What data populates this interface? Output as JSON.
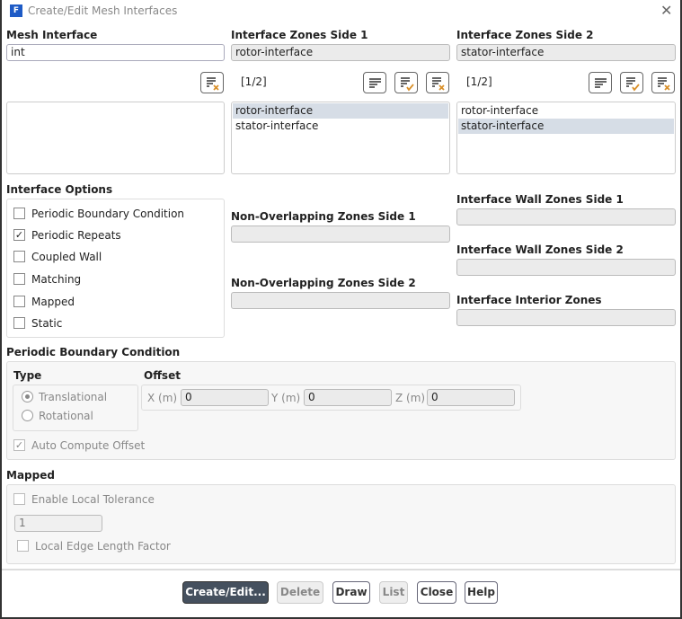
{
  "window": {
    "title": "Create/Edit Mesh Interfaces",
    "app_icon": "F"
  },
  "mesh_interface": {
    "label": "Mesh Interface",
    "value": "int"
  },
  "side1": {
    "label": "Interface Zones Side 1",
    "value": "rotor-interface",
    "count": "[1/2]",
    "items": [
      "rotor-interface",
      "stator-interface"
    ],
    "selected": 0
  },
  "side2": {
    "label": "Interface Zones Side 2",
    "value": "stator-interface",
    "count": "[1/2]",
    "items": [
      "rotor-interface",
      "stator-interface"
    ],
    "selected": 1
  },
  "interface_options": {
    "label": "Interface Options",
    "items": [
      {
        "label": "Periodic Boundary Condition",
        "checked": false
      },
      {
        "label": "Periodic Repeats",
        "checked": true
      },
      {
        "label": "Coupled Wall",
        "checked": false
      },
      {
        "label": "Matching",
        "checked": false
      },
      {
        "label": "Mapped",
        "checked": false
      },
      {
        "label": "Static",
        "checked": false
      }
    ]
  },
  "non_overlap": {
    "side1": "Non-Overlapping Zones Side 1",
    "side2": "Non-Overlapping Zones Side 2"
  },
  "wall": {
    "side1": "Interface Wall Zones Side 1",
    "side2": "Interface Wall Zones Side 2",
    "interior": "Interface Interior Zones"
  },
  "periodic": {
    "label": "Periodic Boundary Condition",
    "type_label": "Type",
    "translational": "Translational",
    "rotational": "Rotational",
    "offset_label": "Offset",
    "x_label": "X (m)",
    "x": "0",
    "y_label": "Y (m)",
    "y": "0",
    "z_label": "Z (m)",
    "z": "0",
    "auto_compute": "Auto Compute Offset"
  },
  "mapped": {
    "label": "Mapped",
    "enable_tol": "Enable Local Tolerance",
    "tol": "1",
    "edge_factor": "Local Edge Length Factor"
  },
  "buttons": {
    "create": "Create/Edit...",
    "delete": "Delete",
    "draw": "Draw",
    "list": "List",
    "close": "Close",
    "help": "Help"
  }
}
